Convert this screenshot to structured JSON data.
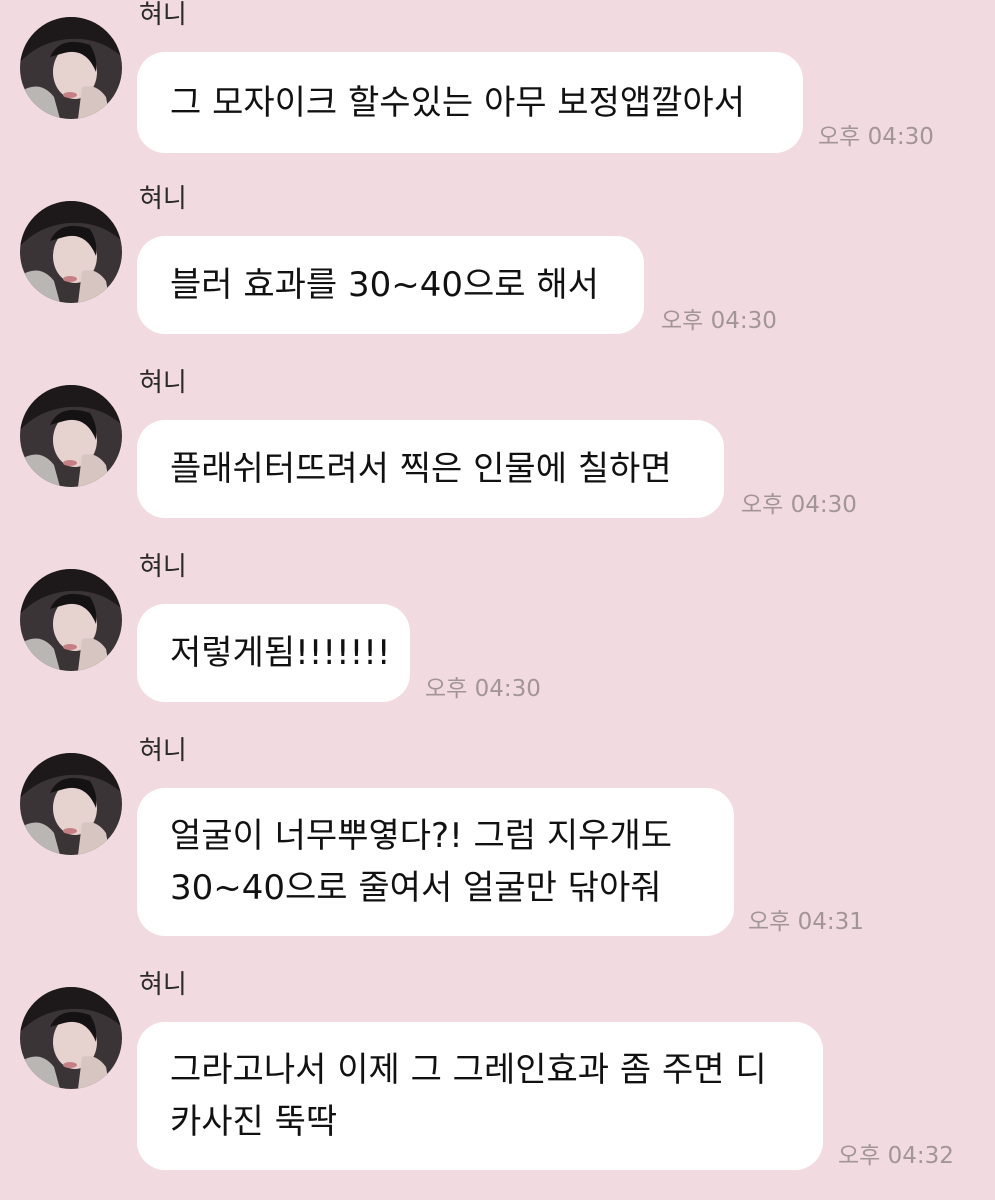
{
  "messages": [
    {
      "sender": "혀니",
      "lines": [
        "그 모자이크 할수있는 아무 보정앱깔아서"
      ],
      "time": "오후 04:30"
    },
    {
      "sender": "혀니",
      "lines": [
        "블러 효과를 30~40으로 해서"
      ],
      "time": "오후 04:30"
    },
    {
      "sender": "혀니",
      "lines": [
        "플래쉬터뜨려서 찍은 인물에 칠하면"
      ],
      "time": "오후 04:30"
    },
    {
      "sender": "혀니",
      "lines": [
        "저렇게됨!!!!!!!"
      ],
      "time": "오후 04:30"
    },
    {
      "sender": "혀니",
      "lines": [
        "얼굴이 너무뿌옇다?! 그럼 지우개도",
        "30~40으로 줄여서 얼굴만 닦아줘"
      ],
      "time": "오후 04:31"
    },
    {
      "sender": "혀니",
      "lines": [
        "그라고나서 이제 그 그레인효과 좀 주면 디",
        "카사진 뚝딱"
      ],
      "time": "오후 04:32"
    }
  ]
}
